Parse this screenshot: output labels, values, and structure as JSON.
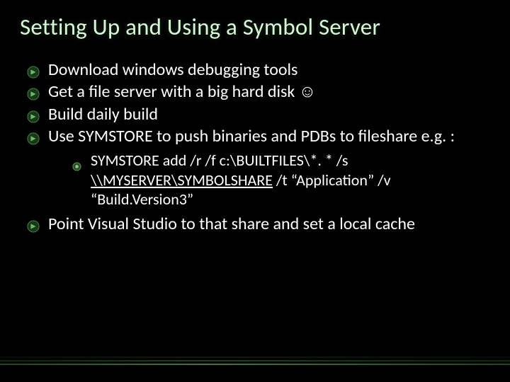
{
  "slide": {
    "title": "Setting Up and Using a Symbol Server",
    "bullets": [
      {
        "text": "Download windows debugging tools"
      },
      {
        "text": "Get a file server with a big hard disk ☺"
      },
      {
        "text": "Build daily build"
      },
      {
        "text_pre": "Use SYMSTORE to push binaries and PDBs to fileshare e.g. :",
        "sub": {
          "pre": "SYMSTORE add /r /f c:\\BUILTFILES\\*. * /s ",
          "link": "\\\\MYSERVER\\SYMBOLSHARE",
          "post": " /t “Application” /v “Build.Version3”"
        }
      },
      {
        "text": "Point Visual Studio to that share and set a local cache"
      }
    ],
    "icons": {
      "main_bullet": "arrow-circle-icon",
      "sub_bullet": "dot-icon"
    },
    "colors": {
      "title": "#d8f5d8",
      "accent": "#3a7a3a",
      "bg": "#000000"
    }
  }
}
